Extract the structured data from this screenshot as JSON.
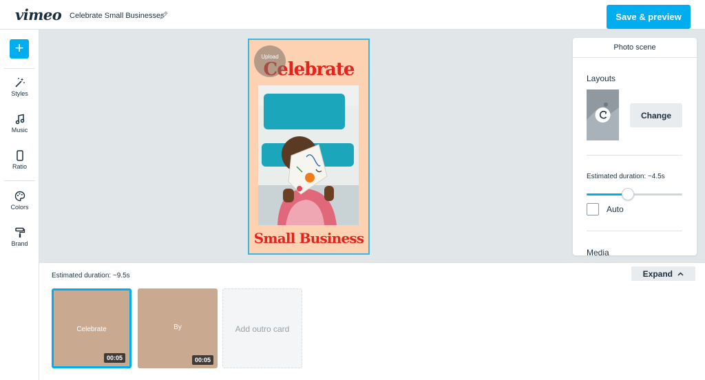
{
  "header": {
    "logo": "vimeo",
    "project_title": "Celebrate Small Businesses",
    "save_label": "Save & preview"
  },
  "sidebar": {
    "add_label": "+",
    "items": [
      {
        "label": "Styles",
        "icon": "magic-wand-icon"
      },
      {
        "label": "Music",
        "icon": "music-note-icon"
      },
      {
        "label": "Ratio",
        "icon": "phone-ratio-icon"
      },
      {
        "label": "Colors",
        "icon": "palette-icon"
      },
      {
        "label": "Brand",
        "icon": "paint-roller-icon"
      }
    ]
  },
  "preview": {
    "upload_label": "Upload",
    "title": "Celebrate",
    "subtitle": "Small Business"
  },
  "panel": {
    "title": "Photo scene",
    "layouts_label": "Layouts",
    "change_label": "Change",
    "duration_label": "Estimated duration: ~4.5s",
    "duration_fraction": 0.43,
    "auto_label": "Auto",
    "auto_checked": false,
    "media_label": "Media"
  },
  "timeline": {
    "duration_label": "Estimated duration: ~9.5s",
    "expand_label": "Expand",
    "clips": [
      {
        "label": "Celebrate",
        "time": "00:05",
        "selected": true
      },
      {
        "label": "By",
        "time": "00:05",
        "selected": false
      }
    ],
    "outro_label": "Add outro card"
  },
  "colors": {
    "accent": "#00adef",
    "card_background": "#fdd2b3",
    "card_text": "#e3231c",
    "clip_background": "#c9a98f"
  }
}
